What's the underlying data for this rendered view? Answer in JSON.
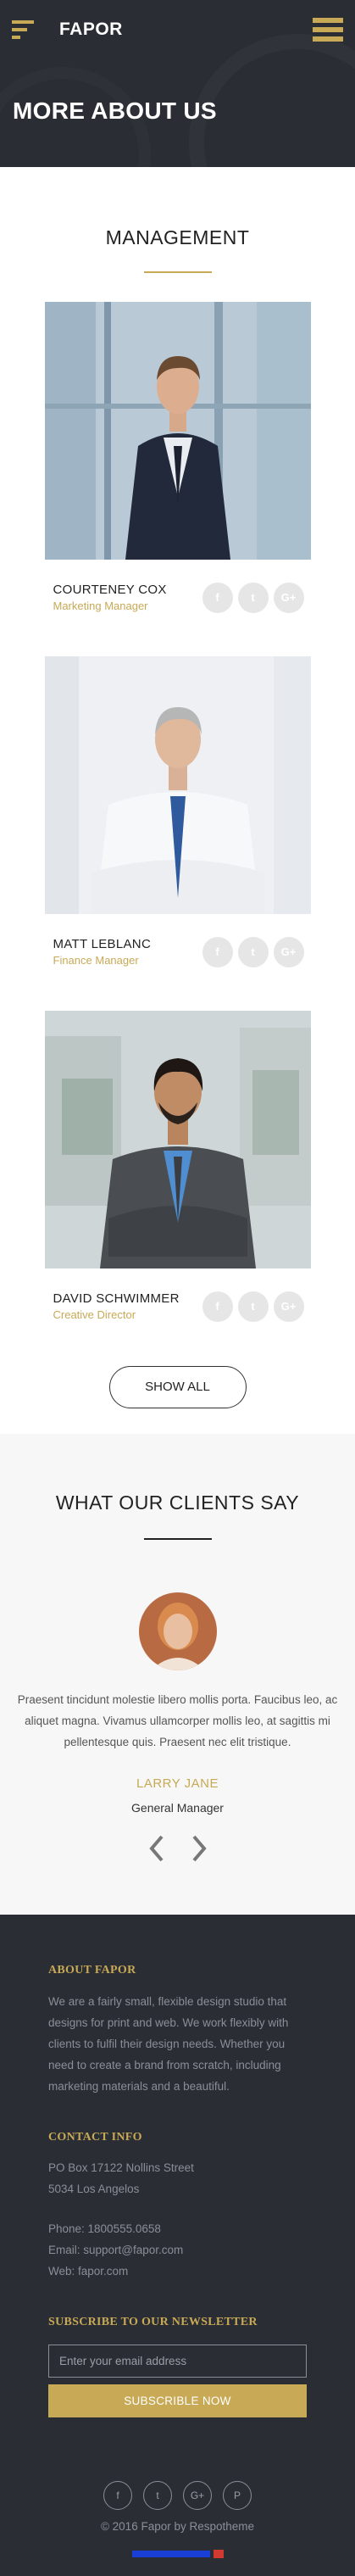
{
  "header": {
    "brand": "FAPOR",
    "hero_title": "MORE ABOUT US"
  },
  "management": {
    "title": "MANAGEMENT",
    "members": [
      {
        "name": "COURTENEY COX",
        "role": "Marketing Manager"
      },
      {
        "name": "MATT LEBLANC",
        "role": "Finance Manager"
      },
      {
        "name": "DAVID SCHWIMMER",
        "role": "Creative Director"
      }
    ],
    "social_icons": [
      "f",
      "t",
      "G+"
    ],
    "show_all": "SHOW ALL"
  },
  "clients": {
    "title": "WHAT OUR CLIENTS SAY",
    "quote": "Praesent tincidunt molestie libero mollis porta. Faucibus leo, ac aliquet magna. Vivamus ullamcorper mollis leo, at sagittis mi pellentesque quis. Praesent nec elit tristique.",
    "client_name": "LARRY JANE",
    "client_role": "General Manager"
  },
  "footer": {
    "about_heading": "ABOUT FAPOR",
    "about_text": "We are a fairly small, flexible design studio that designs for print and web. We work flexibly with clients to fulfil their design needs. Whether you need to create a brand from scratch, including marketing materials and a beautiful.",
    "contact_heading": "CONTACT INFO",
    "address_line1": "PO Box 17122 Nollins Street",
    "address_line2": "5034 Los Angelos",
    "phone": "Phone: 1800555.0658",
    "email": "Email: support@fapor.com",
    "web": "Web: fapor.com",
    "newsletter_heading": "SUBSCRIBE TO OUR NEWSLETTER",
    "email_placeholder": "Enter your email address",
    "subscribe_label": "SUBSCRIBLE NOW",
    "social_icons": [
      "f",
      "t",
      "G+",
      "P"
    ],
    "copyright": "© 2016 Fapor by Respotheme"
  },
  "colors": {
    "accent": "#c7a956",
    "dark": "#2a2d34"
  }
}
